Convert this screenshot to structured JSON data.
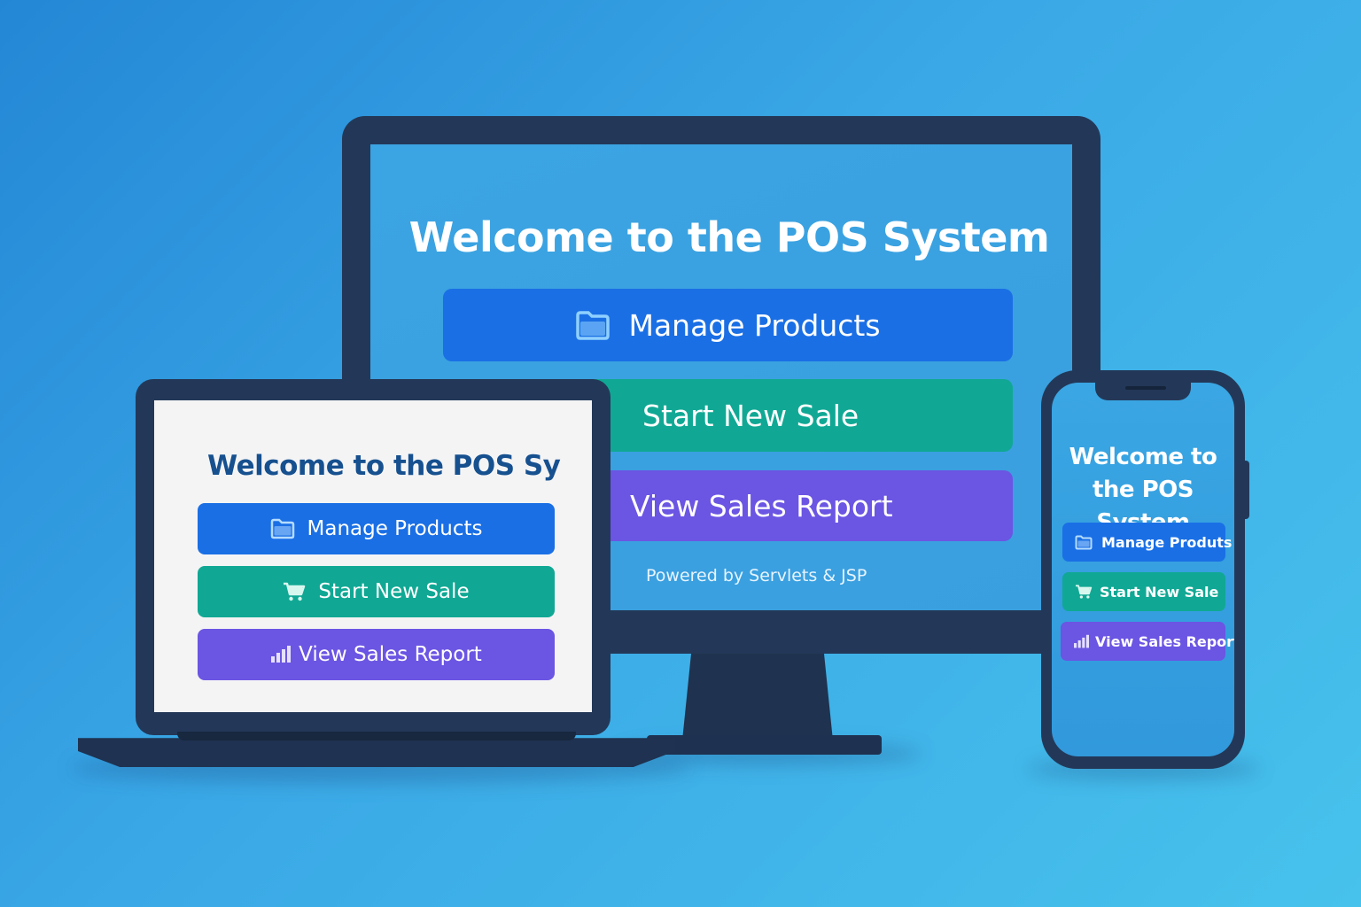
{
  "monitor": {
    "title": "Welcome to the POS System",
    "buttons": {
      "manage_products": "Manage Products",
      "start_new_sale": "Start New Sale",
      "view_sales_report": "View Sales Report"
    },
    "footer": "Powered by Servlets & JSP"
  },
  "laptop": {
    "title": "Welcome to the POS Sy",
    "buttons": {
      "manage_products": "Manage Products",
      "start_new_sale": "Start New Sale",
      "view_sales_report": "View Sales Report"
    }
  },
  "phone": {
    "title_line1": "Welcome to",
    "title_line2": "the POS System",
    "buttons": {
      "manage_products": "Manage Produts",
      "start_new_sale": "Start New Sale",
      "view_sales_report": "View Sales Report"
    }
  },
  "icons": {
    "products": "folder-icon",
    "sale": "cart-icon",
    "report": "bar-chart-icon"
  },
  "colors": {
    "primary_blue": "#1a6fe5",
    "sale_green": "#10a894",
    "report_purple": "#6b55e3",
    "device_frame": "#233858"
  }
}
